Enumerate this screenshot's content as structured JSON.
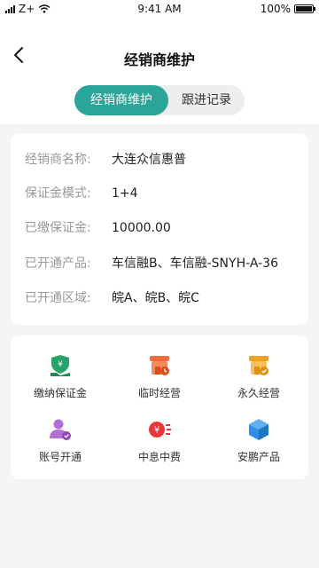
{
  "status": {
    "carrier": "Z+",
    "time": "9:41 AM",
    "battery": "100%",
    "battery_level": 1.0
  },
  "nav": {
    "title": "经销商维护"
  },
  "tabs": [
    {
      "label": "经销商维护",
      "active": true
    },
    {
      "label": "跟进记录",
      "active": false
    }
  ],
  "info": {
    "rows": [
      {
        "label": "经销商名称:",
        "value": "大连众信惠普"
      },
      {
        "label": "保证金模式:",
        "value": "1+4"
      },
      {
        "label": "已缴保证金:",
        "value": "10000.00"
      },
      {
        "label": "已开通产品:",
        "value": "车信融B、车信融-SNYH-A-36"
      },
      {
        "label": "已开通区域:",
        "value": "皖A、皖B、皖C"
      }
    ]
  },
  "actions": [
    {
      "label": "缴纳保证金",
      "icon": "deposit-shield-icon",
      "color": "#27a36a"
    },
    {
      "label": "临时经营",
      "icon": "temporary-shop-icon",
      "color": "#ef6b3b"
    },
    {
      "label": "永久经营",
      "icon": "permanent-shop-icon",
      "color": "#f5b03a"
    },
    {
      "label": "账号开通",
      "icon": "user-account-icon",
      "color": "#b36fd6"
    },
    {
      "label": "中息中费",
      "icon": "interest-fee-icon",
      "color": "#e8363a"
    },
    {
      "label": "安鹏产品",
      "icon": "cube-product-icon",
      "color": "#2f8fe6"
    }
  ]
}
